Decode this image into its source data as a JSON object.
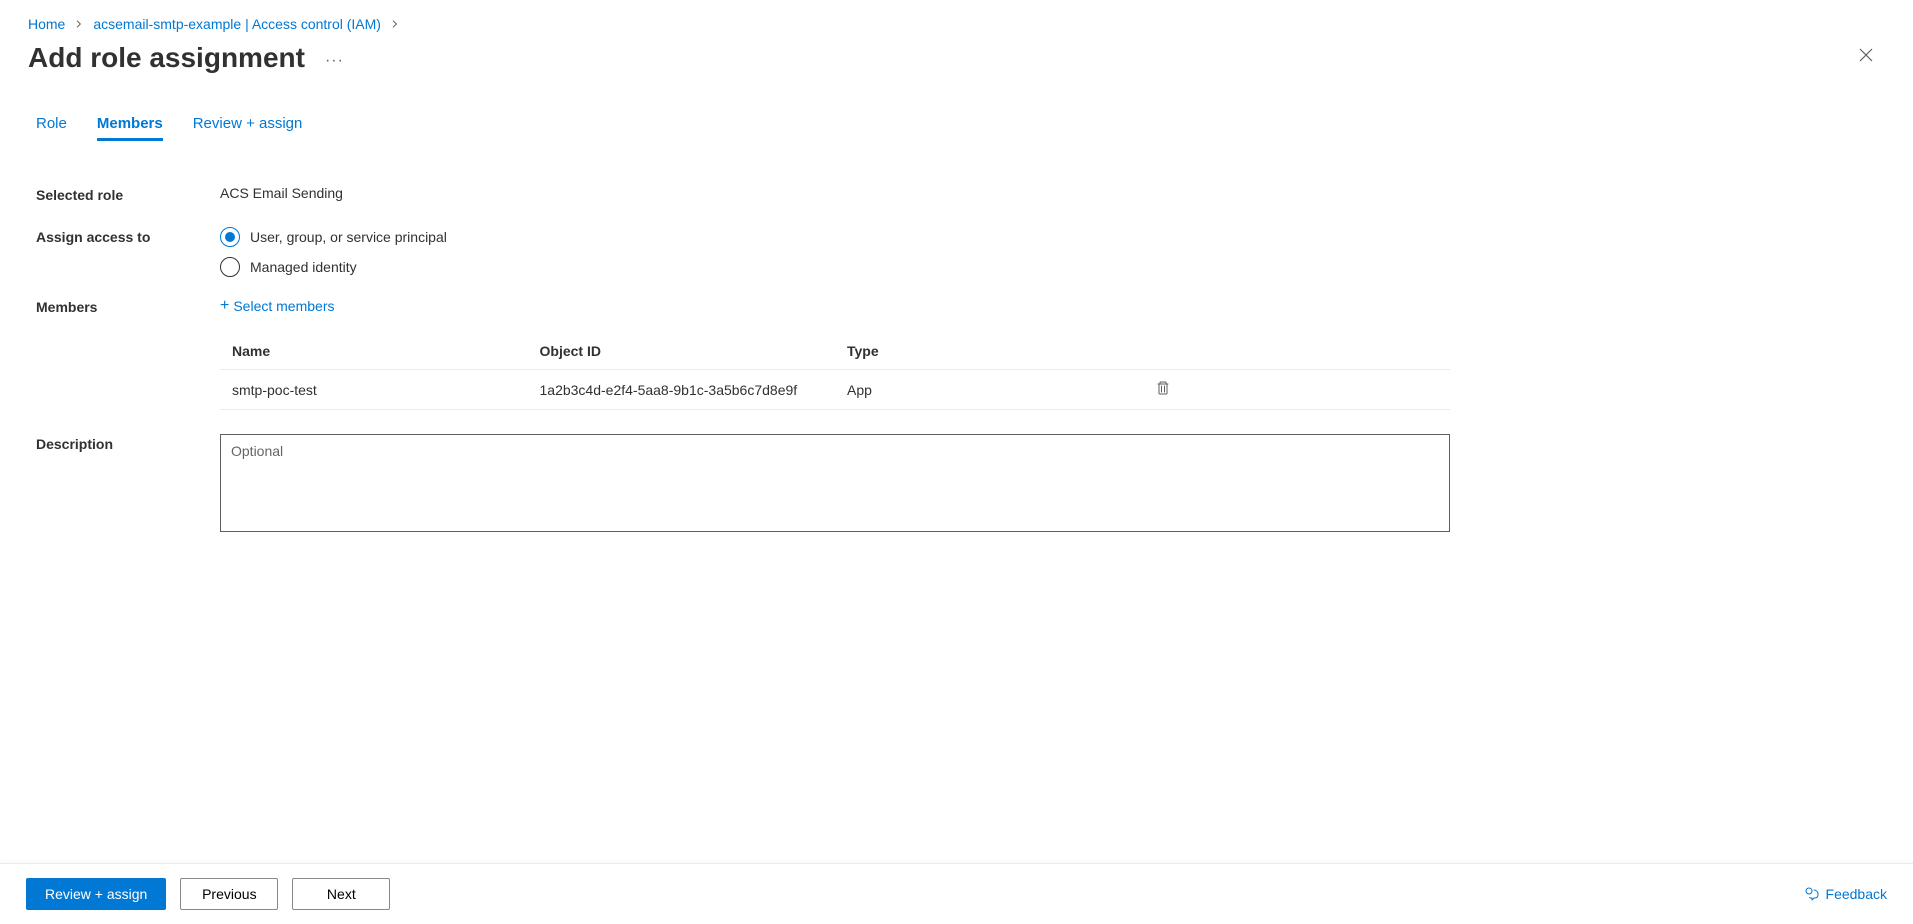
{
  "breadcrumb": {
    "items": [
      {
        "label": "Home"
      },
      {
        "label": "acsemail-smtp-example | Access control (IAM)"
      }
    ]
  },
  "page_title": "Add role assignment",
  "tabs": [
    {
      "label": "Role",
      "active": false
    },
    {
      "label": "Members",
      "active": true
    },
    {
      "label": "Review + assign",
      "active": false
    }
  ],
  "form": {
    "selected_role_label": "Selected role",
    "selected_role_value": "ACS Email Sending",
    "assign_access_label": "Assign access to",
    "assign_options": [
      {
        "label": "User, group, or service principal",
        "checked": true
      },
      {
        "label": "Managed identity",
        "checked": false
      }
    ],
    "members_label": "Members",
    "select_members_label": "Select members",
    "members_table": {
      "headers": {
        "name": "Name",
        "object_id": "Object ID",
        "type": "Type"
      },
      "rows": [
        {
          "name": "smtp-poc-test",
          "object_id": "1a2b3c4d-e2f4-5aa8-9b1c-3a5b6c7d8e9f",
          "type": "App"
        }
      ]
    },
    "description_label": "Description",
    "description_placeholder": "Optional",
    "description_value": ""
  },
  "footer": {
    "review_assign_label": "Review + assign",
    "previous_label": "Previous",
    "next_label": "Next",
    "feedback_label": "Feedback"
  }
}
